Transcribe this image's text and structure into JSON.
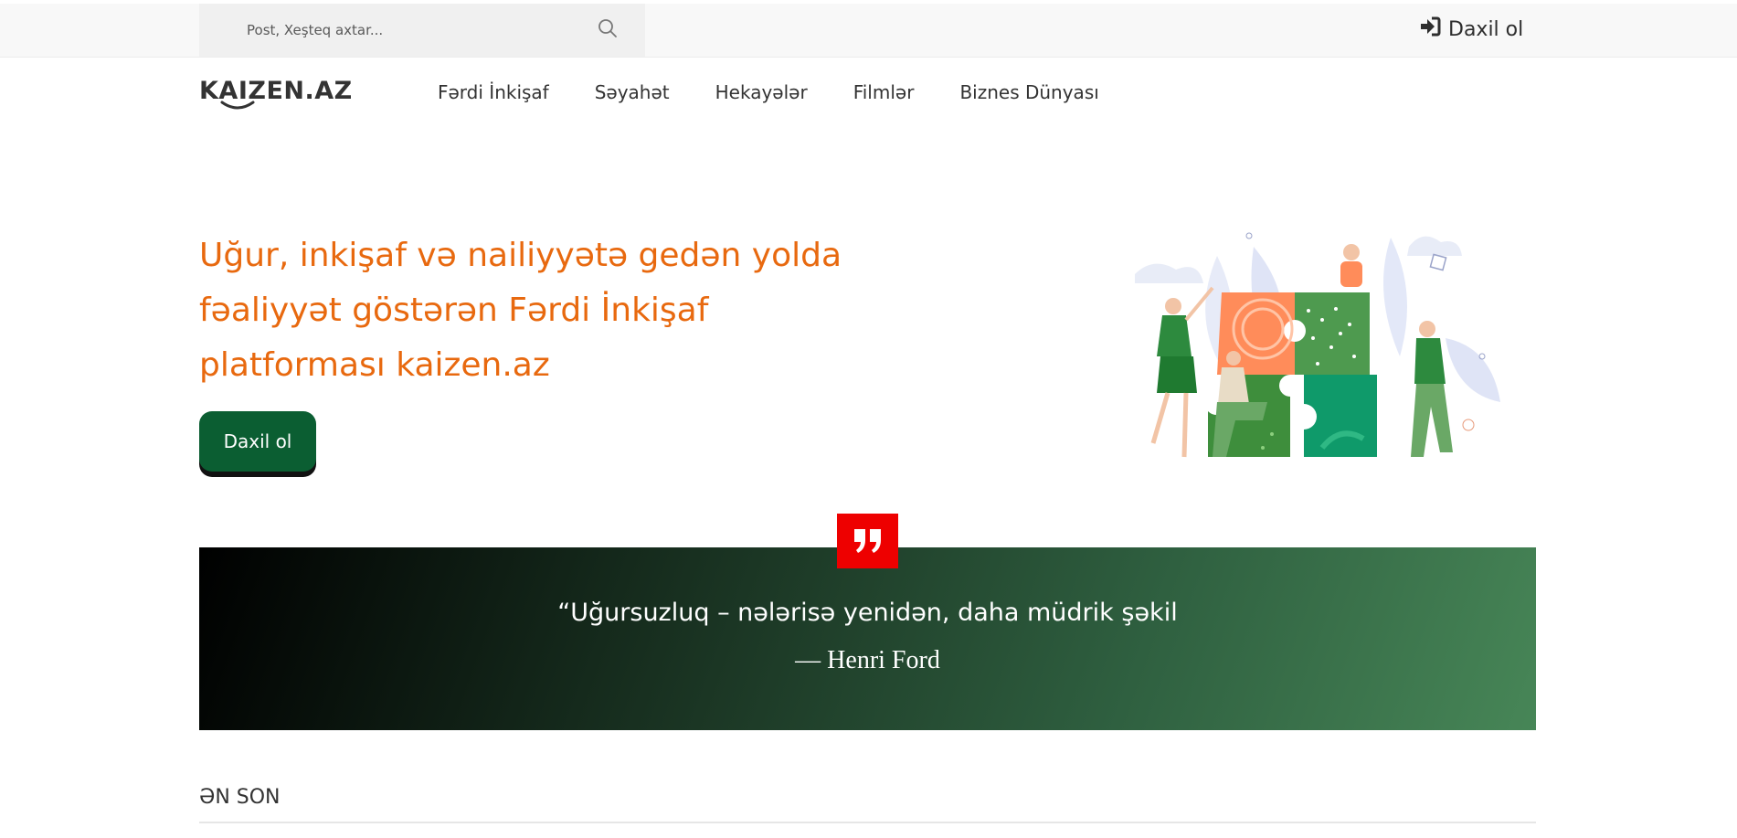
{
  "topbar": {
    "search_placeholder": "Post, Xeşteq axtar...",
    "search_icon": "search-icon",
    "login_icon": "sign-in-icon",
    "login_label": "Daxil ol"
  },
  "header": {
    "logo": "KAIZEN.AZ",
    "nav": [
      "Fərdi İnkişaf",
      "Səyahət",
      "Hekayələr",
      "Filmlər",
      "Biznes Dünyası"
    ]
  },
  "hero": {
    "title": "Uğur, inkişaf və nailiyyətə gedən yolda fəaliyyət göstərən Fərdi İnkişaf platforması kaizen.az",
    "button_label": "Daxil ol",
    "illustration": "puzzle-team-illustration",
    "accent_color": "#e8690f",
    "button_color": "#0b5e32"
  },
  "quote": {
    "icon": "quote-icon",
    "text": "“Uğursuzluq – nələrisə yenidən, daha müdrik şəkil",
    "author": "— Henri Ford",
    "icon_color": "#ee0000"
  },
  "latest": {
    "title": "ƏN SON"
  }
}
